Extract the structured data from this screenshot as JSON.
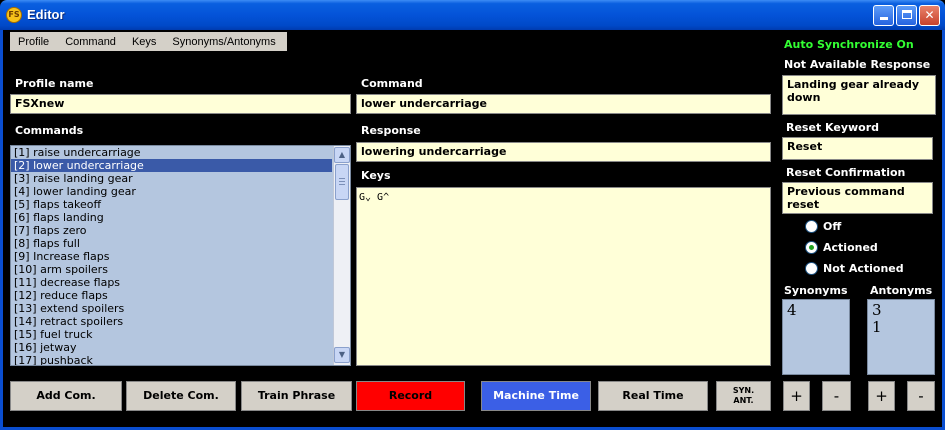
{
  "window": {
    "title": "Editor",
    "app_icon_label": "FS"
  },
  "menu": [
    "Profile",
    "Command",
    "Keys",
    "Synonyms/Antonyms"
  ],
  "profile": {
    "label": "Profile name",
    "value": "FSXnew"
  },
  "commands": {
    "label": "Commands",
    "selected_index": 1,
    "items": [
      "[1] raise undercarriage",
      "[2] lower undercarriage",
      "[3] raise landing gear",
      "[4] lower landing gear",
      "[5] flaps takeoff",
      "[6] flaps landing",
      "[7] flaps zero",
      "[8] flaps full",
      "[9] Increase flaps",
      "[10] arm spoilers",
      "[11] decrease flaps",
      "[12] reduce flaps",
      "[13] extend spoilers",
      "[14] retract spoilers",
      "[15] fuel truck",
      "[16] jetway",
      "[17] pushback"
    ]
  },
  "command": {
    "label": "Command",
    "value": "lower undercarriage"
  },
  "response": {
    "label": "Response",
    "value": "lowering undercarriage"
  },
  "keys": {
    "label": "Keys",
    "value": "G⌄ G^"
  },
  "right_panel": {
    "auto_sync": "Auto Synchronize On",
    "not_available_label": "Not Available Response",
    "not_available_value": "Landing gear already down",
    "reset_keyword_label": "Reset Keyword",
    "reset_keyword_value": "Reset",
    "reset_confirmation_label": "Reset Confirmation",
    "reset_confirmation_value": "Previous command reset",
    "radio": [
      {
        "label": "Off",
        "checked": false
      },
      {
        "label": "Actioned",
        "checked": true
      },
      {
        "label": "Not Actioned",
        "checked": false
      }
    ],
    "synonyms_label": "Synonyms",
    "synonyms": [
      "4"
    ],
    "antonyms_label": "Antonyms",
    "antonyms": [
      "3",
      "1"
    ]
  },
  "buttons": {
    "add": "Add Com.",
    "delete": "Delete Com.",
    "train": "Train Phrase",
    "record": "Record",
    "machine_time": "Machine Time",
    "real_time": "Real Time",
    "syn_ant_line1": "SYN.",
    "syn_ant_line2": "ANT.",
    "plus": "+",
    "minus": "-"
  },
  "colors": {
    "title_bar": "#0453d8",
    "field_bg": "#ffffd8",
    "list_bg": "#b4c6df",
    "list_selected": "#3a5aa8",
    "record_btn": "#ff0000",
    "machine_time_btn": "#3b5fe6",
    "auto_sync_text": "#33ff33"
  }
}
